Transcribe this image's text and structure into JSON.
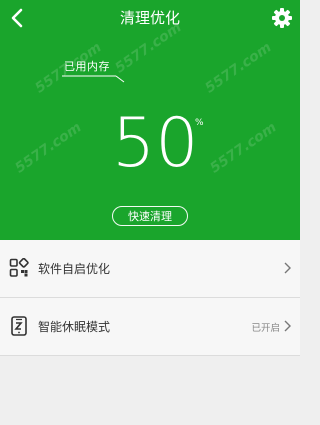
{
  "header": {
    "title": "清理优化",
    "back_icon": "chevron-left-icon",
    "settings_icon": "gear-icon"
  },
  "memory": {
    "label": "已用内存",
    "value": "50",
    "unit": "%",
    "clean_button_label": "快速清理",
    "used_percent": 50
  },
  "list": {
    "items": [
      {
        "label": "软件自启优化",
        "icon": "app-grid-icon",
        "status": ""
      },
      {
        "label": "智能休眠模式",
        "icon": "sleep-phone-icon",
        "status": "已开启"
      }
    ]
  },
  "theme": {
    "accent": "#1aa52c",
    "background": "#efefef"
  }
}
